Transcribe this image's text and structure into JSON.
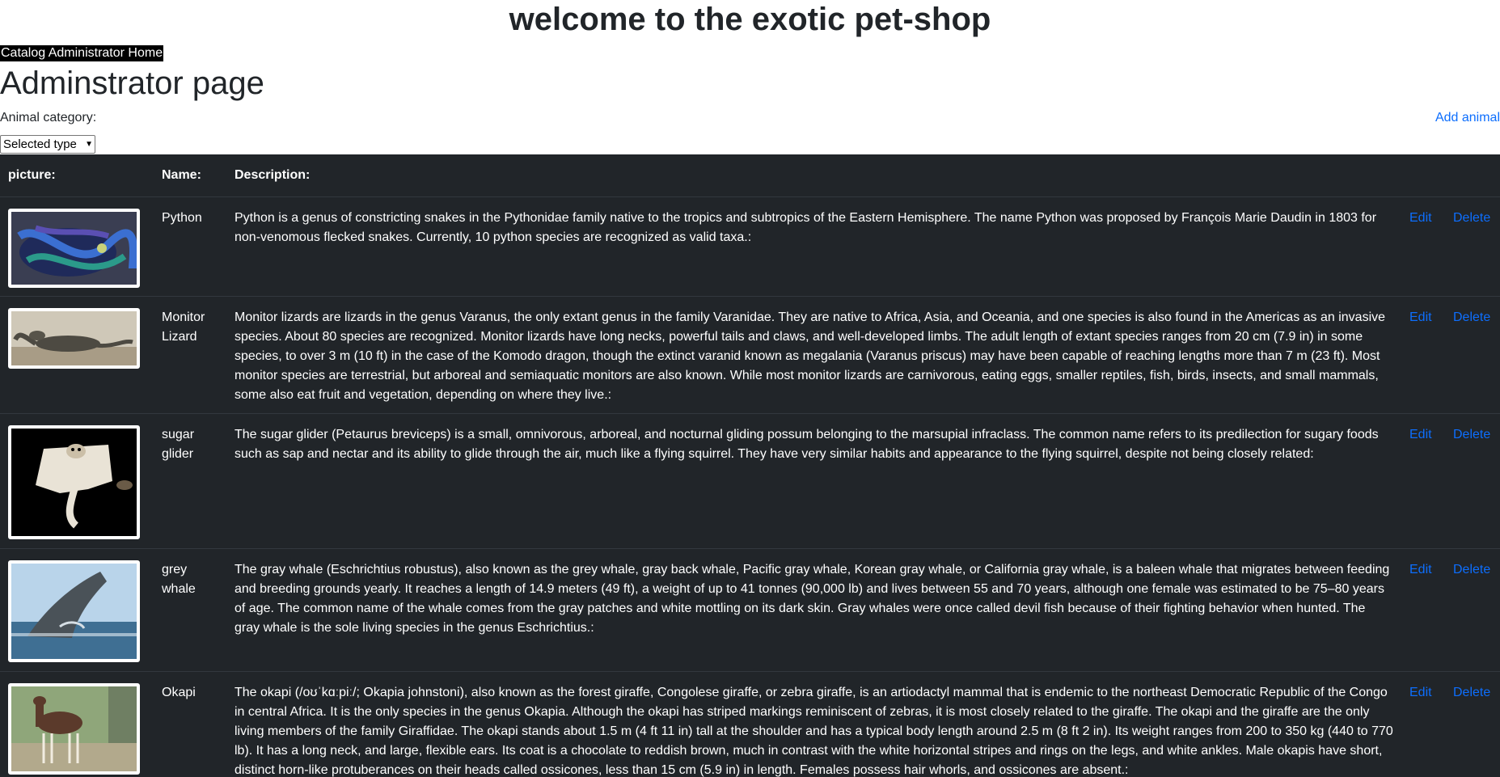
{
  "header": {
    "site_title": "welcome to the exotic pet-shop",
    "nav_links": [
      "Catalog",
      "Administrator",
      "Home"
    ]
  },
  "page": {
    "title": "Adminstrator page",
    "category_label": "Animal category:",
    "add_link": "Add animal",
    "select_value": "Selected type"
  },
  "table": {
    "headers": [
      "picture:",
      "Name:",
      "Description:"
    ],
    "edit_label": "Edit",
    "delete_label": "Delete",
    "rows": [
      {
        "name": "Python",
        "description": "Python is a genus of constricting snakes in the Pythonidae family native to the tropics and subtropics of the Eastern Hemisphere. The name Python was proposed by François Marie Daudin in 1803 for non-venomous flecked snakes. Currently, 10 python species are recognized as valid taxa.:"
      },
      {
        "name": "Monitor Lizard",
        "description": "Monitor lizards are lizards in the genus Varanus, the only extant genus in the family Varanidae. They are native to Africa, Asia, and Oceania, and one species is also found in the Americas as an invasive species. About 80 species are recognized. Monitor lizards have long necks, powerful tails and claws, and well-developed limbs. The adult length of extant species ranges from 20 cm (7.9 in) in some species, to over 3 m (10 ft) in the case of the Komodo dragon, though the extinct varanid known as megalania (Varanus priscus) may have been capable of reaching lengths more than 7 m (23 ft). Most monitor species are terrestrial, but arboreal and semiaquatic monitors are also known. While most monitor lizards are carnivorous, eating eggs, smaller reptiles, fish, birds, insects, and small mammals, some also eat fruit and vegetation, depending on where they live.:"
      },
      {
        "name": "sugar glider",
        "description": "The sugar glider (Petaurus breviceps) is a small, omnivorous, arboreal, and nocturnal gliding possum belonging to the marsupial infraclass. The common name refers to its predilection for sugary foods such as sap and nectar and its ability to glide through the air, much like a flying squirrel. They have very similar habits and appearance to the flying squirrel, despite not being closely related:"
      },
      {
        "name": "grey whale",
        "description": "The gray whale (Eschrichtius robustus), also known as the grey whale, gray back whale, Pacific gray whale, Korean gray whale, or California gray whale, is a baleen whale that migrates between feeding and breeding grounds yearly. It reaches a length of 14.9 meters (49 ft), a weight of up to 41 tonnes (90,000 lb) and lives between 55 and 70 years, although one female was estimated to be 75–80 years of age. The common name of the whale comes from the gray patches and white mottling on its dark skin. Gray whales were once called devil fish because of their fighting behavior when hunted. The gray whale is the sole living species in the genus Eschrichtius.:"
      },
      {
        "name": "Okapi",
        "description": "The okapi (/oʊˈkɑːpiː/; Okapia johnstoni), also known as the forest giraffe, Congolese giraffe, or zebra giraffe, is an artiodactyl mammal that is endemic to the northeast Democratic Republic of the Congo in central Africa. It is the only species in the genus Okapia. Although the okapi has striped markings reminiscent of zebras, it is most closely related to the giraffe. The okapi and the giraffe are the only living members of the family Giraffidae. The okapi stands about 1.5 m (4 ft 11 in) tall at the shoulder and has a typical body length around 2.5 m (8 ft 2 in). Its weight ranges from 200 to 350 kg (440 to 770 lb). It has a long neck, and large, flexible ears. Its coat is a chocolate to reddish brown, much in contrast with the white horizontal stripes and rings on the legs, and white ankles. Male okapis have short, distinct horn-like protuberances on their heads called ossicones, less than 15 cm (5.9 in) in length. Females possess hair whorls, and ossicones are absent.:"
      }
    ]
  },
  "colors": {
    "table_bg": "#212529",
    "link": "#0d6efd",
    "text": "#212529"
  }
}
